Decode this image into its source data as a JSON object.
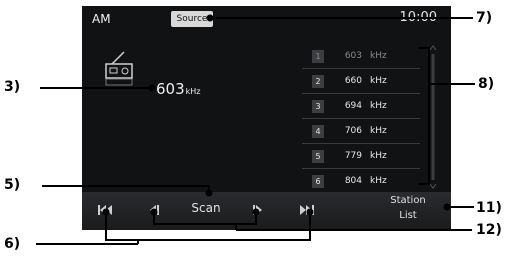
{
  "screen": {
    "band": "AM",
    "source_label": "Source",
    "clock": "10:00"
  },
  "station": {
    "frequency": "603",
    "unit": "kHz"
  },
  "presets": [
    {
      "num": "1",
      "freq": "603",
      "unit": "kHz"
    },
    {
      "num": "2",
      "freq": "660",
      "unit": "kHz"
    },
    {
      "num": "3",
      "freq": "694",
      "unit": "kHz"
    },
    {
      "num": "4",
      "freq": "706",
      "unit": "kHz"
    },
    {
      "num": "5",
      "freq": "779",
      "unit": "kHz"
    },
    {
      "num": "6",
      "freq": "804",
      "unit": "kHz"
    }
  ],
  "controls": {
    "scan_label": "Scan",
    "station_list_line1": "Station",
    "station_list_line2": "List",
    "icons": [
      "skip-back-icon",
      "step-back-icon",
      "step-forward-icon",
      "skip-forward-icon"
    ]
  },
  "callouts": {
    "c3": "3)",
    "c5": "5)",
    "c6": "6)",
    "c7": "7)",
    "c8": "8)",
    "c11": "11)",
    "c12": "12)"
  }
}
